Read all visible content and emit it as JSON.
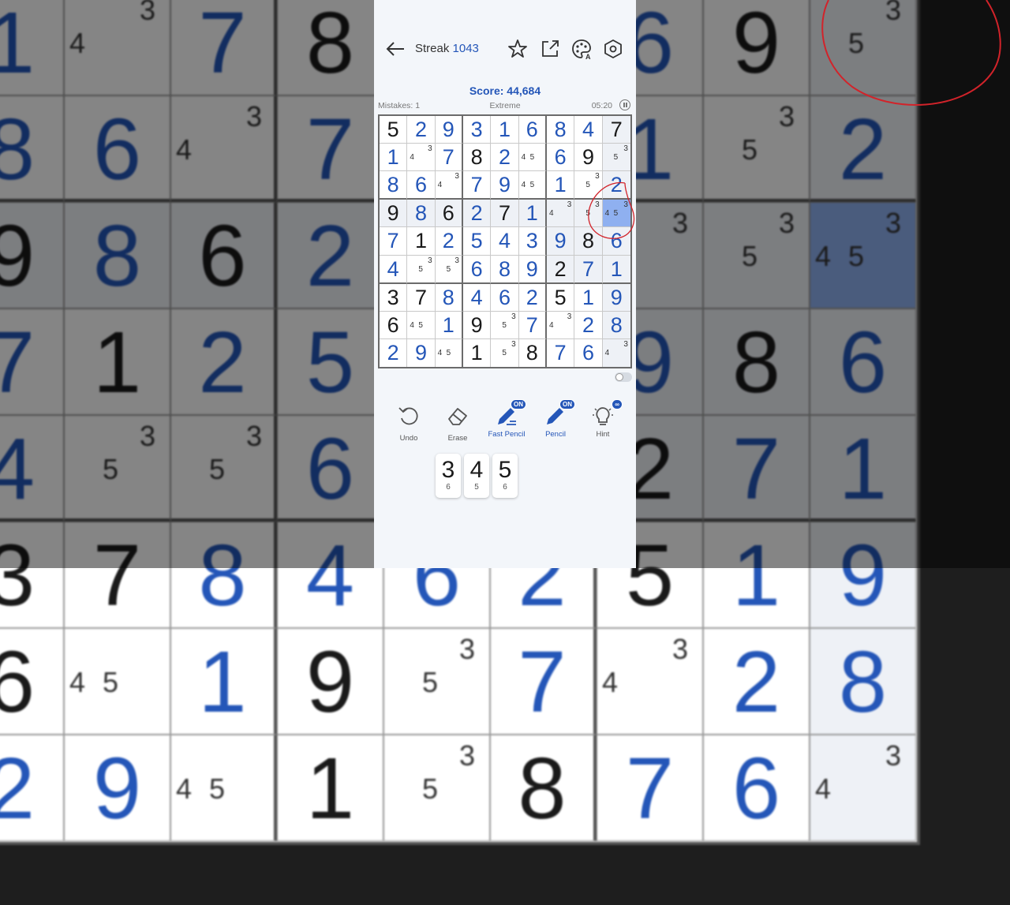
{
  "header": {
    "title": "Streak",
    "streak": "1043"
  },
  "score_label": "Score: 44,684",
  "mistakes": "Mistakes: 1",
  "difficulty": "Extreme",
  "timer": "05:20",
  "icons": {
    "back": "arrow-left-icon",
    "favorite": "star-icon",
    "share": "share-icon",
    "theme": "palette-icon",
    "settings": "settings-hexagon-icon"
  },
  "colors": {
    "user_digit": "#2456b8",
    "given_digit": "#1a1a1a",
    "selected_cell": "#8fb0f0",
    "annotation": "#d2232a"
  },
  "board": [
    [
      "5",
      "u2",
      "u9",
      "u3",
      "u1",
      "u6",
      "u8",
      "u4",
      "7"
    ],
    [
      "u1",
      "p:4,3",
      "u7",
      "8",
      "u2",
      "p:4,5",
      "u6",
      "9",
      "p:3,5"
    ],
    [
      "u8",
      "u6",
      "p:4,3",
      "u7",
      "u9",
      "p:4,5",
      "u1",
      "p:5,3",
      "u2"
    ],
    [
      "9",
      "u8",
      "6",
      "u2",
      "7",
      "u1",
      "p:4,3",
      "p:5,3",
      "p:3,4,5"
    ],
    [
      "u7",
      "1",
      "u2",
      "u5",
      "u4",
      "u3",
      "u9",
      "8",
      "u6"
    ],
    [
      "u4",
      "p:3,5",
      "p:3,5",
      "u6",
      "u8",
      "u9",
      "2",
      "u7",
      "u1"
    ],
    [
      "3",
      "7",
      "u8",
      "u4",
      "u6",
      "u2",
      "5",
      "u1",
      "u9"
    ],
    [
      "6",
      "p:4,5",
      "u1",
      "9",
      "p:3,5",
      "u7",
      "p:4,3",
      "u2",
      "u8"
    ],
    [
      "u2",
      "u9",
      "p:4,5",
      "1",
      "p:3,5",
      "8",
      "u7",
      "u6",
      "p:3,4"
    ]
  ],
  "selected": {
    "row": 3,
    "col": 8
  },
  "tools": [
    {
      "label": "Undo",
      "icon": "undo-icon",
      "badge": ""
    },
    {
      "label": "Erase",
      "icon": "eraser-icon",
      "badge": ""
    },
    {
      "label": "Fast Pencil",
      "icon": "fast-pencil-icon",
      "badge": "ON"
    },
    {
      "label": "Pencil",
      "icon": "pencil-icon",
      "badge": "ON"
    },
    {
      "label": "Hint",
      "icon": "lightbulb-icon",
      "badge": "∞"
    }
  ],
  "candidates": [
    {
      "digit": "3",
      "count": "6"
    },
    {
      "digit": "4",
      "count": "5"
    },
    {
      "digit": "5",
      "count": "6"
    }
  ]
}
